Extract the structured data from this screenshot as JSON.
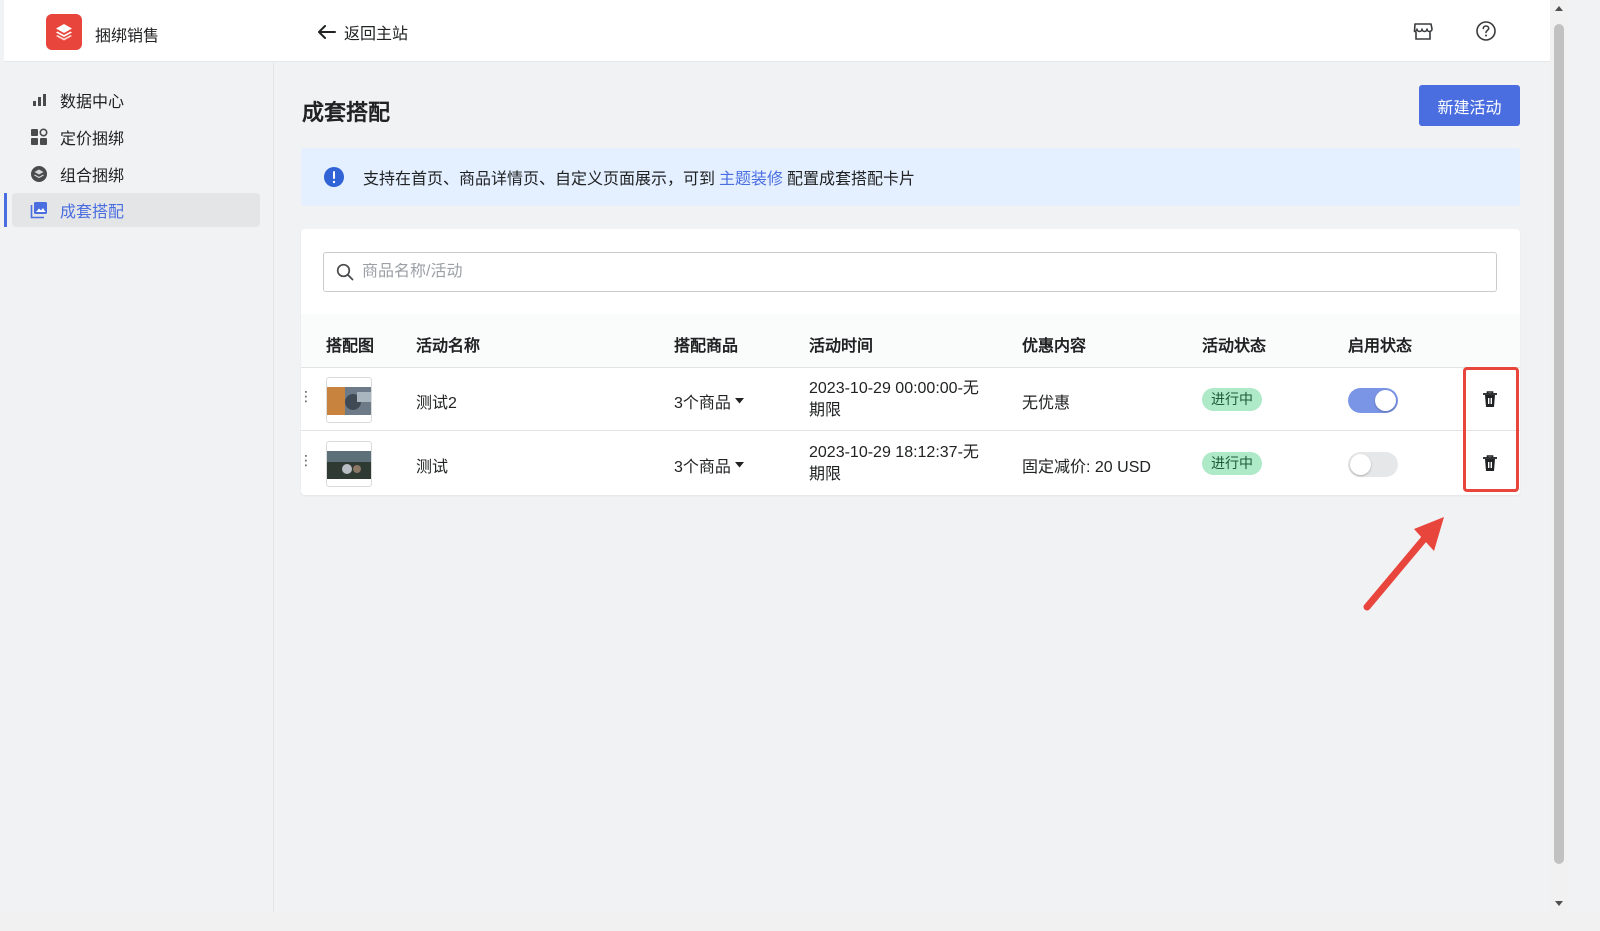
{
  "header": {
    "app_name": "捆绑销售",
    "back_label": "返回主站"
  },
  "sidebar": {
    "items": [
      {
        "label": "数据中心",
        "icon": "bar-chart-icon"
      },
      {
        "label": "定价捆绑",
        "icon": "grid-icon"
      },
      {
        "label": "组合捆绑",
        "icon": "layers-icon"
      },
      {
        "label": "成套搭配",
        "icon": "image-stack-icon",
        "active": true
      }
    ]
  },
  "page": {
    "title": "成套搭配",
    "new_button": "新建活动"
  },
  "banner": {
    "text_before": "支持在首页、商品详情页、自定义页面展示，可到",
    "link": "主题装修",
    "text_after": "配置成套搭配卡片"
  },
  "search": {
    "placeholder": "商品名称/活动"
  },
  "table": {
    "headers": [
      "搭配图",
      "活动名称",
      "搭配商品",
      "活动时间",
      "优惠内容",
      "活动状态",
      "启用状态"
    ],
    "rows": [
      {
        "name": "测试2",
        "products": "3个商品",
        "time_line1": "2023-10-29 00:00:00-无",
        "time_line2": "期限",
        "discount": "无优惠",
        "status": "进行中",
        "enabled": true
      },
      {
        "name": "测试",
        "products": "3个商品",
        "time_line1": "2023-10-29 18:12:37-无",
        "time_line2": "期限",
        "discount": "固定减价: 20 USD",
        "status": "进行中",
        "enabled": false
      }
    ]
  },
  "colors": {
    "accent": "#4a6ee0",
    "logo": "#e8453c",
    "badge_bg": "#aee9c8",
    "annotation": "#e8453c"
  }
}
